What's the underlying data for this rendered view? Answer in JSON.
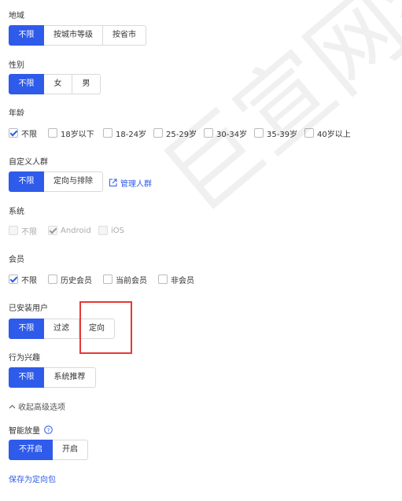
{
  "region": {
    "label": "地域",
    "options": [
      "不限",
      "按城市等级",
      "按省市"
    ],
    "selected": "不限"
  },
  "gender": {
    "label": "性别",
    "options": [
      "不限",
      "女",
      "男"
    ],
    "selected": "不限"
  },
  "age": {
    "label": "年龄",
    "options": [
      "不限",
      "18岁以下",
      "18-24岁",
      "25-29岁",
      "30-34岁",
      "35-39岁",
      "40岁以上"
    ],
    "checked": [
      "不限"
    ]
  },
  "custom_audience": {
    "label": "自定义人群",
    "options": [
      "不限",
      "定向与排除"
    ],
    "selected": "不限",
    "manage_link": "管理人群"
  },
  "system": {
    "label": "系统",
    "options": [
      "不限",
      "Android",
      "iOS"
    ],
    "checked": [
      "Android"
    ],
    "disabled": true
  },
  "membership": {
    "label": "会员",
    "options": [
      "不限",
      "历史会员",
      "当前会员",
      "非会员"
    ],
    "checked": [
      "不限"
    ]
  },
  "installed_users": {
    "label": "已安装用户",
    "options": [
      "不限",
      "过滤",
      "定向"
    ],
    "selected": "不限"
  },
  "behavior_interest": {
    "label": "行为兴趣",
    "options": [
      "不限",
      "系统推荐"
    ],
    "selected": "不限"
  },
  "collapse_link": "收起高级选项",
  "smart_boost": {
    "label": "智能放量",
    "options": [
      "不开启",
      "开启"
    ],
    "selected": "不开启"
  },
  "save_link": "保存为定向包",
  "watermark": "巨宣网络",
  "colors": {
    "accent": "#2f5bea",
    "highlight_box": "#e53935"
  }
}
